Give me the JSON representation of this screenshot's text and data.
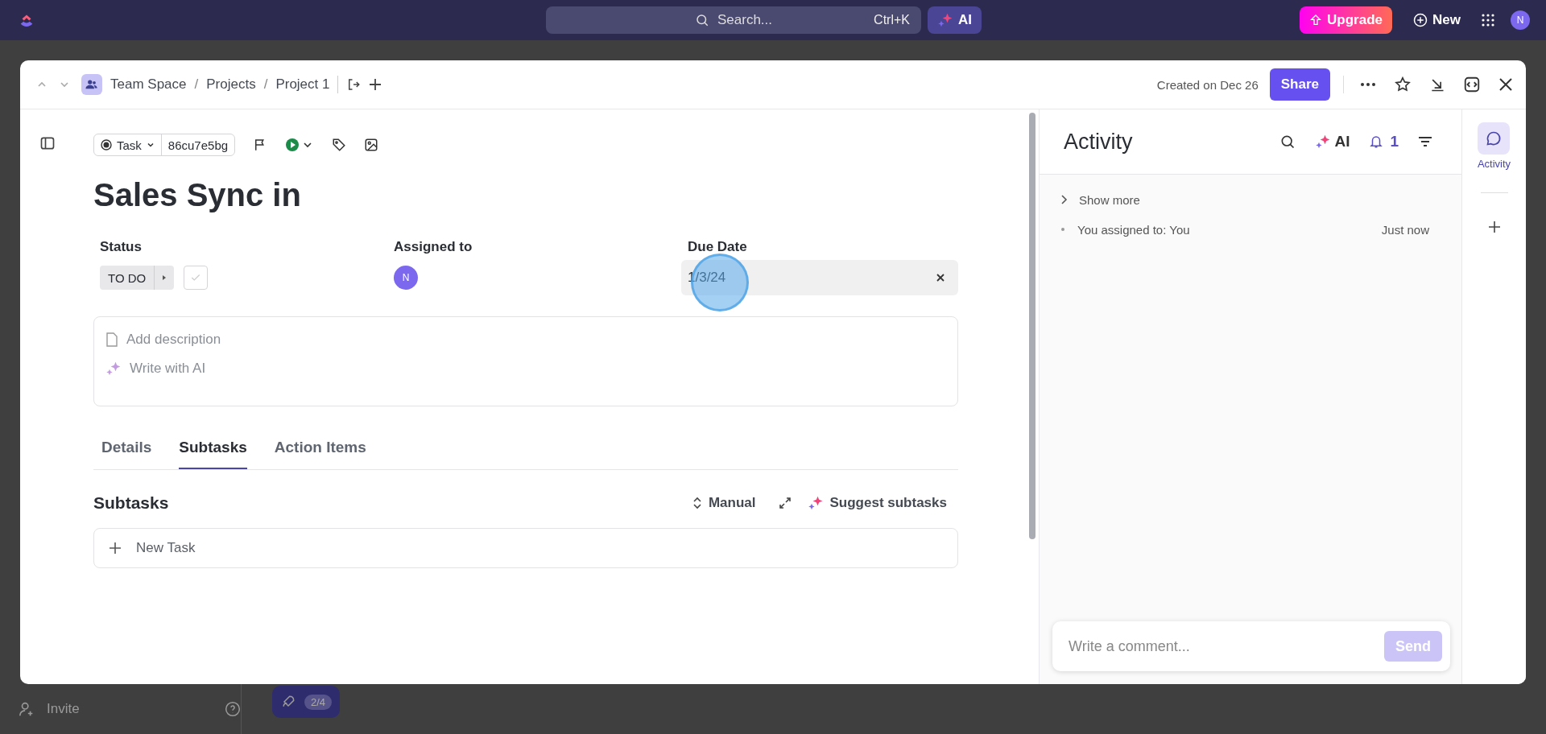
{
  "topbar": {
    "search": {
      "placeholder": "Search...",
      "shortcut": "Ctrl+K"
    },
    "ai": "AI",
    "upgrade": "Upgrade",
    "new": "New",
    "avatar": "N"
  },
  "modal": {
    "breadcrumb": [
      "Team Space",
      "Projects",
      "Project 1"
    ],
    "breadcrumb_separator": "/",
    "created": "Created on Dec 26",
    "share": "Share"
  },
  "task": {
    "type": "Task",
    "id": "86cu7e5bg",
    "title": "Sales Sync in",
    "fields": [
      {
        "kind": "status",
        "label": "Status",
        "value": "TO DO",
        "checked": false
      },
      {
        "kind": "assignee",
        "label": "Assigned to",
        "value": "N"
      },
      {
        "kind": "date",
        "label": "Due Date",
        "value": "1/3/24"
      }
    ],
    "description": {
      "placeholder": "Add description",
      "ai": "Write with AI"
    },
    "tabs": [
      {
        "label": "Details",
        "selected": false
      },
      {
        "label": "Subtasks",
        "selected": true
      },
      {
        "label": "Action Items",
        "selected": false
      }
    ],
    "subtasks": {
      "heading": "Subtasks",
      "sort": "Manual",
      "suggest": "Suggest subtasks",
      "new_task": "New Task"
    }
  },
  "activity": {
    "title": "Activity",
    "ai": "AI",
    "notifications": "1",
    "show_more": "Show more",
    "items": [
      {
        "text": "You assigned to: You",
        "time": "Just now"
      }
    ],
    "comment": {
      "placeholder": "Write a comment...",
      "send": "Send"
    }
  },
  "rail": [
    {
      "label": "Activity",
      "selected": true
    }
  ],
  "background": {
    "invite": "Invite",
    "progress": "2/4"
  }
}
